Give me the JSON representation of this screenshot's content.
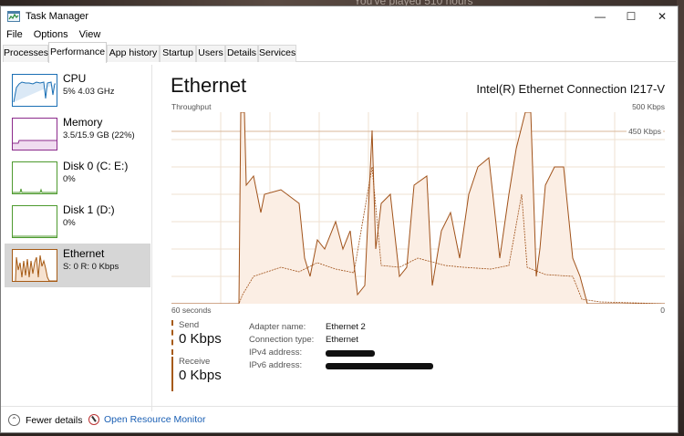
{
  "background": {
    "text": "You've played 510 hours"
  },
  "window": {
    "title": "Task Manager",
    "controls": {
      "minimize": "—",
      "maximize": "☐",
      "close": "✕"
    }
  },
  "menu": [
    "File",
    "Options",
    "View"
  ],
  "tabs": [
    {
      "label": "Processes",
      "active": false
    },
    {
      "label": "Performance",
      "active": true
    },
    {
      "label": "App history",
      "active": false
    },
    {
      "label": "Startup",
      "active": false
    },
    {
      "label": "Users",
      "active": false
    },
    {
      "label": "Details",
      "active": false
    },
    {
      "label": "Services",
      "active": false
    }
  ],
  "sidebar": {
    "items": [
      {
        "title": "CPU",
        "subtitle": "5%  4.03 GHz",
        "color": "#1a6fb4"
      },
      {
        "title": "Memory",
        "subtitle": "3.5/15.9 GB (22%)",
        "color": "#8b2a8b"
      },
      {
        "title": "Disk 0 (C: E:)",
        "subtitle": "0%",
        "color": "#4d9a2e"
      },
      {
        "title": "Disk 1 (D:)",
        "subtitle": "0%",
        "color": "#4d9a2e"
      },
      {
        "title": "Ethernet",
        "subtitle": "S: 0  R: 0 Kbps",
        "color": "#a65a14",
        "selected": true
      }
    ]
  },
  "main": {
    "title": "Ethernet",
    "adapter": "Intel(R) Ethernet Connection I217-V",
    "chart_label": "Throughput",
    "chart_max": "500 Kbps",
    "chart_scale_line": "450 Kbps",
    "time_label": "60 seconds",
    "zero_label": "0"
  },
  "send": {
    "label": "Send",
    "value": "0 Kbps",
    "color": "#a65a14"
  },
  "receive": {
    "label": "Receive",
    "value": "0 Kbps",
    "color": "#a65a14"
  },
  "details": {
    "adapter_name_label": "Adapter name:",
    "adapter_name": "Ethernet 2",
    "connection_type_label": "Connection type:",
    "connection_type": "Ethernet",
    "ipv4_label": "IPv4 address:",
    "ipv6_label": "IPv6 address:"
  },
  "footer": {
    "fewer_details": "Fewer details",
    "resource_monitor": "Open Resource Monitor"
  },
  "colors": {
    "accent": "#a65a14",
    "chart_fill": "#fbeee4",
    "grid": "#efe0d2"
  }
}
